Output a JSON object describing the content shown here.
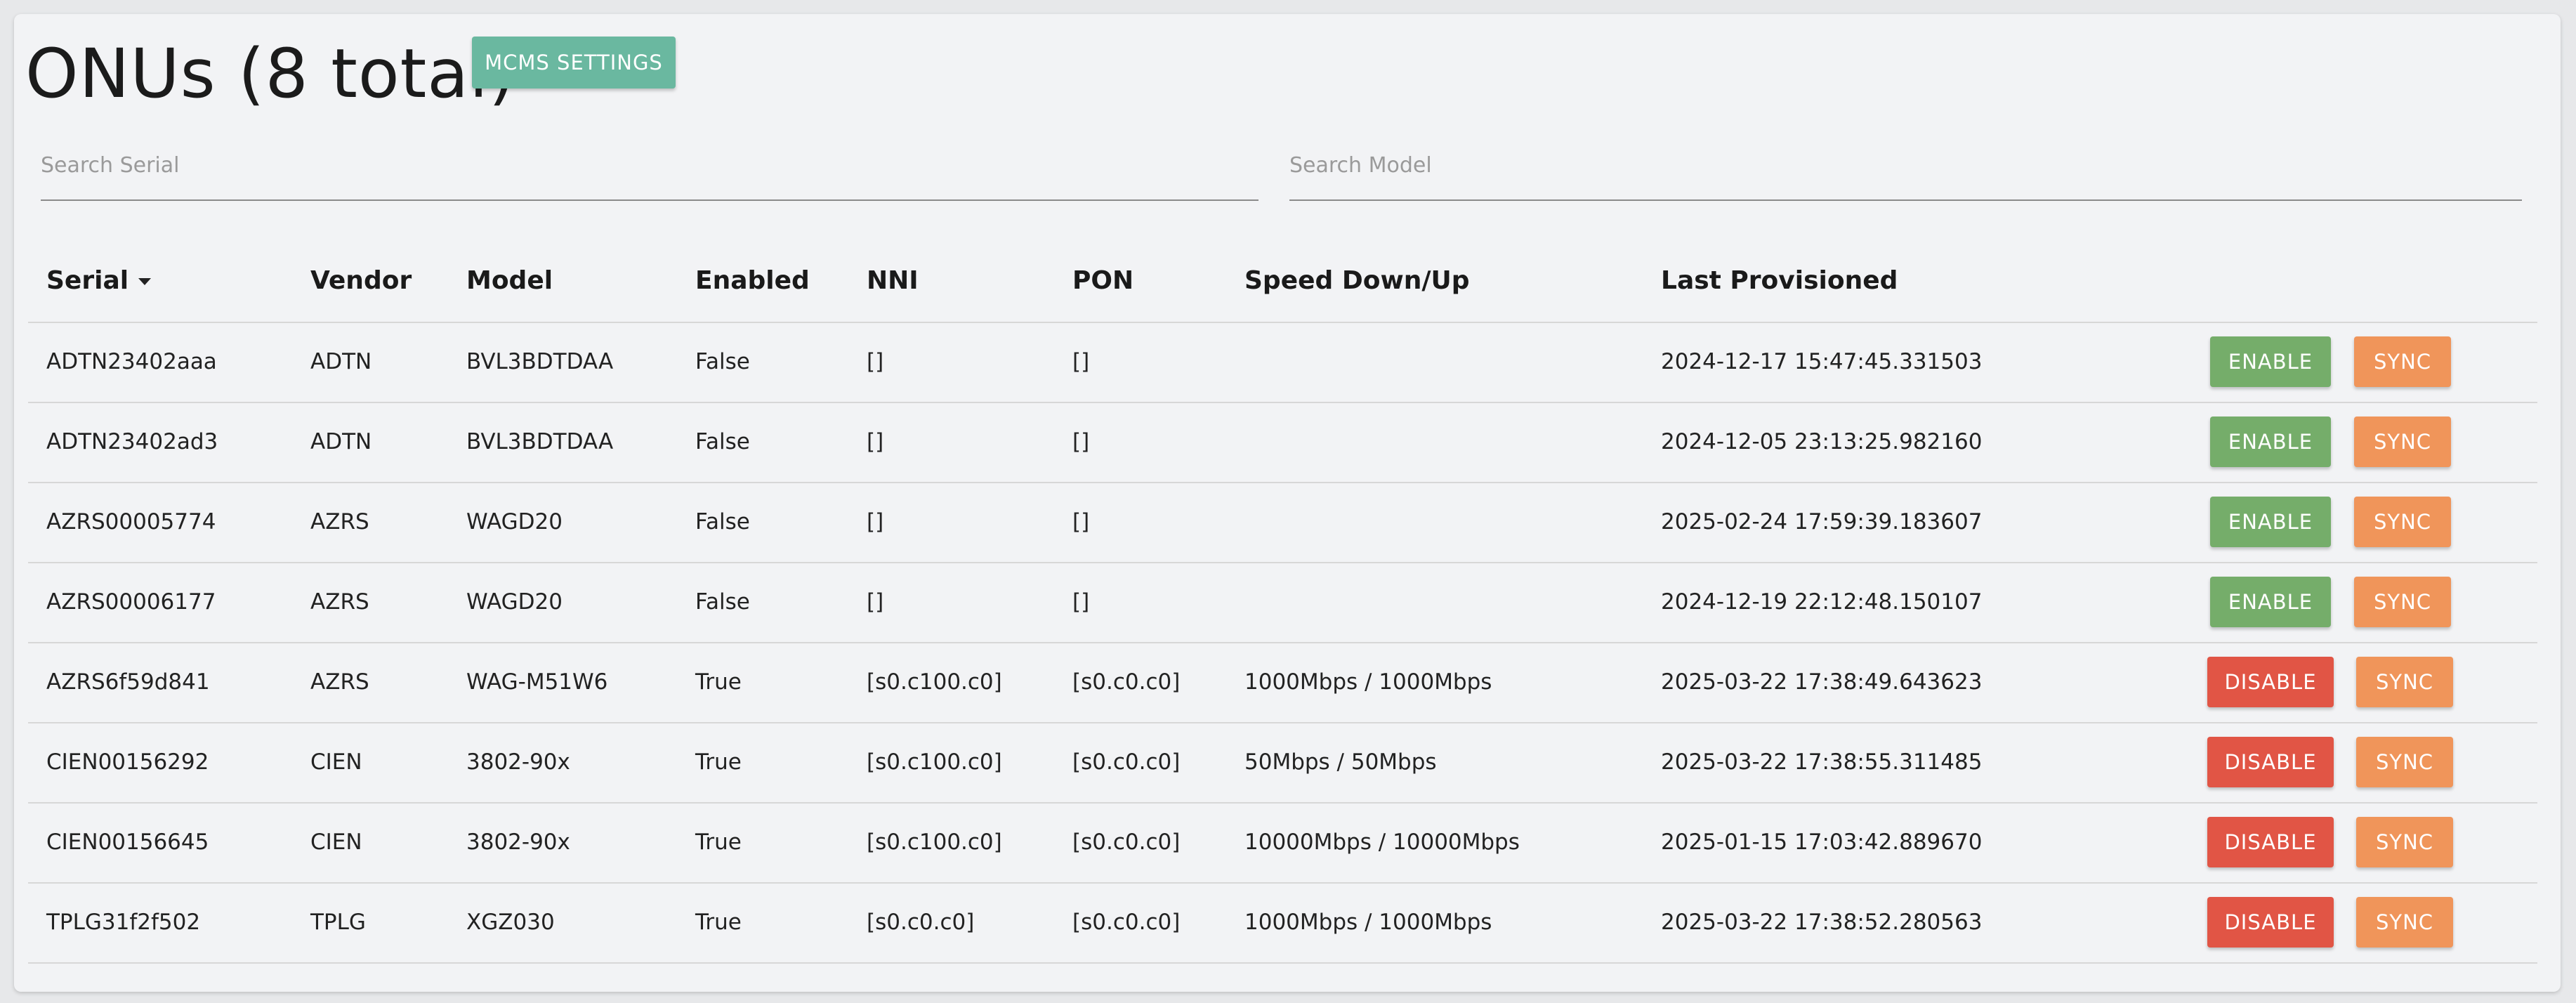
{
  "page": {
    "title": "ONUs (8 total)",
    "mcms_button": "MCMS SETTINGS"
  },
  "search": {
    "serial_placeholder": "Search Serial",
    "serial_value": "",
    "model_placeholder": "Search Model",
    "model_value": ""
  },
  "table": {
    "headers": {
      "serial": "Serial",
      "vendor": "Vendor",
      "model": "Model",
      "enabled": "Enabled",
      "nni": "NNI",
      "pon": "PON",
      "speed": "Speed Down/Up",
      "last_provisioned": "Last Provisioned"
    },
    "sort": {
      "column": "Serial",
      "direction": "descending"
    },
    "rows": [
      {
        "serial": "ADTN23402aaa",
        "vendor": "ADTN",
        "model": "BVL3BDTDAA",
        "enabled": "False",
        "nni": "[]",
        "pon": "[]",
        "speed": "",
        "last_provisioned": "2024-12-17 15:47:45.331503",
        "action": "ENABLE",
        "sync": "SYNC"
      },
      {
        "serial": "ADTN23402ad3",
        "vendor": "ADTN",
        "model": "BVL3BDTDAA",
        "enabled": "False",
        "nni": "[]",
        "pon": "[]",
        "speed": "",
        "last_provisioned": "2024-12-05 23:13:25.982160",
        "action": "ENABLE",
        "sync": "SYNC"
      },
      {
        "serial": "AZRS00005774",
        "vendor": "AZRS",
        "model": "WAGD20",
        "enabled": "False",
        "nni": "[]",
        "pon": "[]",
        "speed": "",
        "last_provisioned": "2025-02-24 17:59:39.183607",
        "action": "ENABLE",
        "sync": "SYNC"
      },
      {
        "serial": "AZRS00006177",
        "vendor": "AZRS",
        "model": "WAGD20",
        "enabled": "False",
        "nni": "[]",
        "pon": "[]",
        "speed": "",
        "last_provisioned": "2024-12-19 22:12:48.150107",
        "action": "ENABLE",
        "sync": "SYNC"
      },
      {
        "serial": "AZRS6f59d841",
        "vendor": "AZRS",
        "model": "WAG-M51W6",
        "enabled": "True",
        "nni": "[s0.c100.c0]",
        "pon": "[s0.c0.c0]",
        "speed": "1000Mbps / 1000Mbps",
        "last_provisioned": "2025-03-22 17:38:49.643623",
        "action": "DISABLE",
        "sync": "SYNC"
      },
      {
        "serial": "CIEN00156292",
        "vendor": "CIEN",
        "model": "3802-90x",
        "enabled": "True",
        "nni": "[s0.c100.c0]",
        "pon": "[s0.c0.c0]",
        "speed": "50Mbps / 50Mbps",
        "last_provisioned": "2025-03-22 17:38:55.311485",
        "action": "DISABLE",
        "sync": "SYNC"
      },
      {
        "serial": "CIEN00156645",
        "vendor": "CIEN",
        "model": "3802-90x",
        "enabled": "True",
        "nni": "[s0.c100.c0]",
        "pon": "[s0.c0.c0]",
        "speed": "10000Mbps / 10000Mbps",
        "last_provisioned": "2025-01-15 17:03:42.889670",
        "action": "DISABLE",
        "sync": "SYNC"
      },
      {
        "serial": "TPLG31f2f502",
        "vendor": "TPLG",
        "model": "XGZ030",
        "enabled": "True",
        "nni": "[s0.c0.c0]",
        "pon": "[s0.c0.c0]",
        "speed": "1000Mbps / 1000Mbps",
        "last_provisioned": "2025-03-22 17:38:52.280563",
        "action": "DISABLE",
        "sync": "SYNC"
      }
    ]
  },
  "colors": {
    "mcms": "#6ab8a0",
    "enable": "#75ad6a",
    "disable": "#e15545",
    "sync": "#f0955a"
  }
}
